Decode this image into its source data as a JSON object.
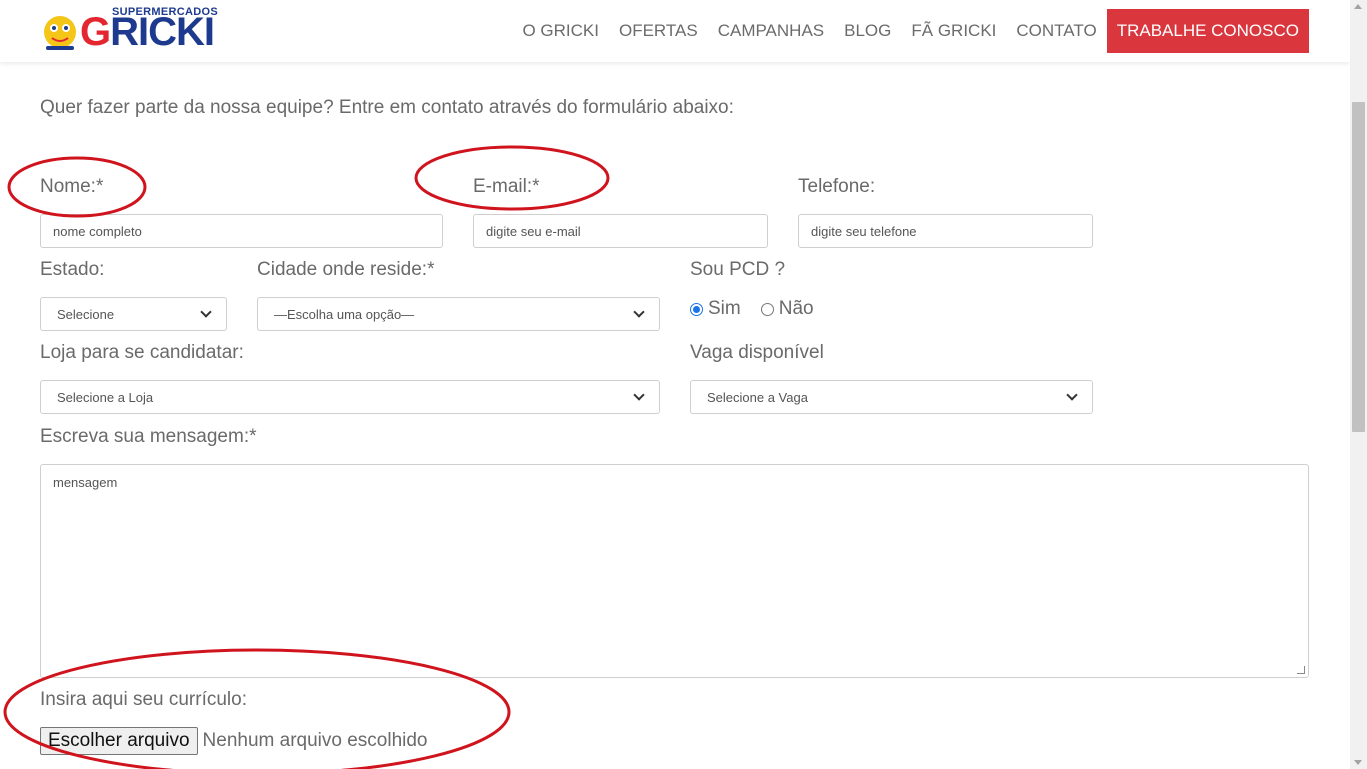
{
  "header": {
    "logo_top": "SUPERMERCADOS",
    "logo_main_a": "G",
    "logo_main_b": "RICKI",
    "nav": [
      "O GRICKI",
      "OFERTAS",
      "CAMPANHAS",
      "BLOG",
      "FÃ GRICKI",
      "CONTATO"
    ],
    "cta": "TRABALHE CONOSCO"
  },
  "form": {
    "intro": "Quer fazer parte da nossa equipe? Entre em contato através do formulário abaixo:",
    "nome_label": "Nome:*",
    "nome_placeholder": "nome completo",
    "email_label": "E-mail:*",
    "email_placeholder": "digite seu e-mail",
    "telefone_label": "Telefone:",
    "telefone_placeholder": "digite seu telefone",
    "estado_label": "Estado:",
    "estado_value": "Selecione",
    "cidade_label": "Cidade onde reside:*",
    "cidade_value": "—Escolha uma opção—",
    "pcd_label": "Sou PCD ?",
    "pcd_sim": "Sim",
    "pcd_nao": "Não",
    "loja_label": "Loja para se candidatar:",
    "loja_value": "Selecione a Loja",
    "vaga_label": "Vaga disponível",
    "vaga_value": "Selecione a Vaga",
    "mensagem_label": "Escreva sua mensagem:*",
    "mensagem_placeholder": "mensagem",
    "curriculo_label": "Insira aqui seu currículo:",
    "file_button": "Escolher arquivo",
    "file_status": "Nenhum arquivo escolhido"
  },
  "colors": {
    "cta_bg": "#d9363e",
    "annotation": "#d0141e",
    "logo_blue": "#1d3a8f",
    "logo_red": "#e3262f"
  }
}
